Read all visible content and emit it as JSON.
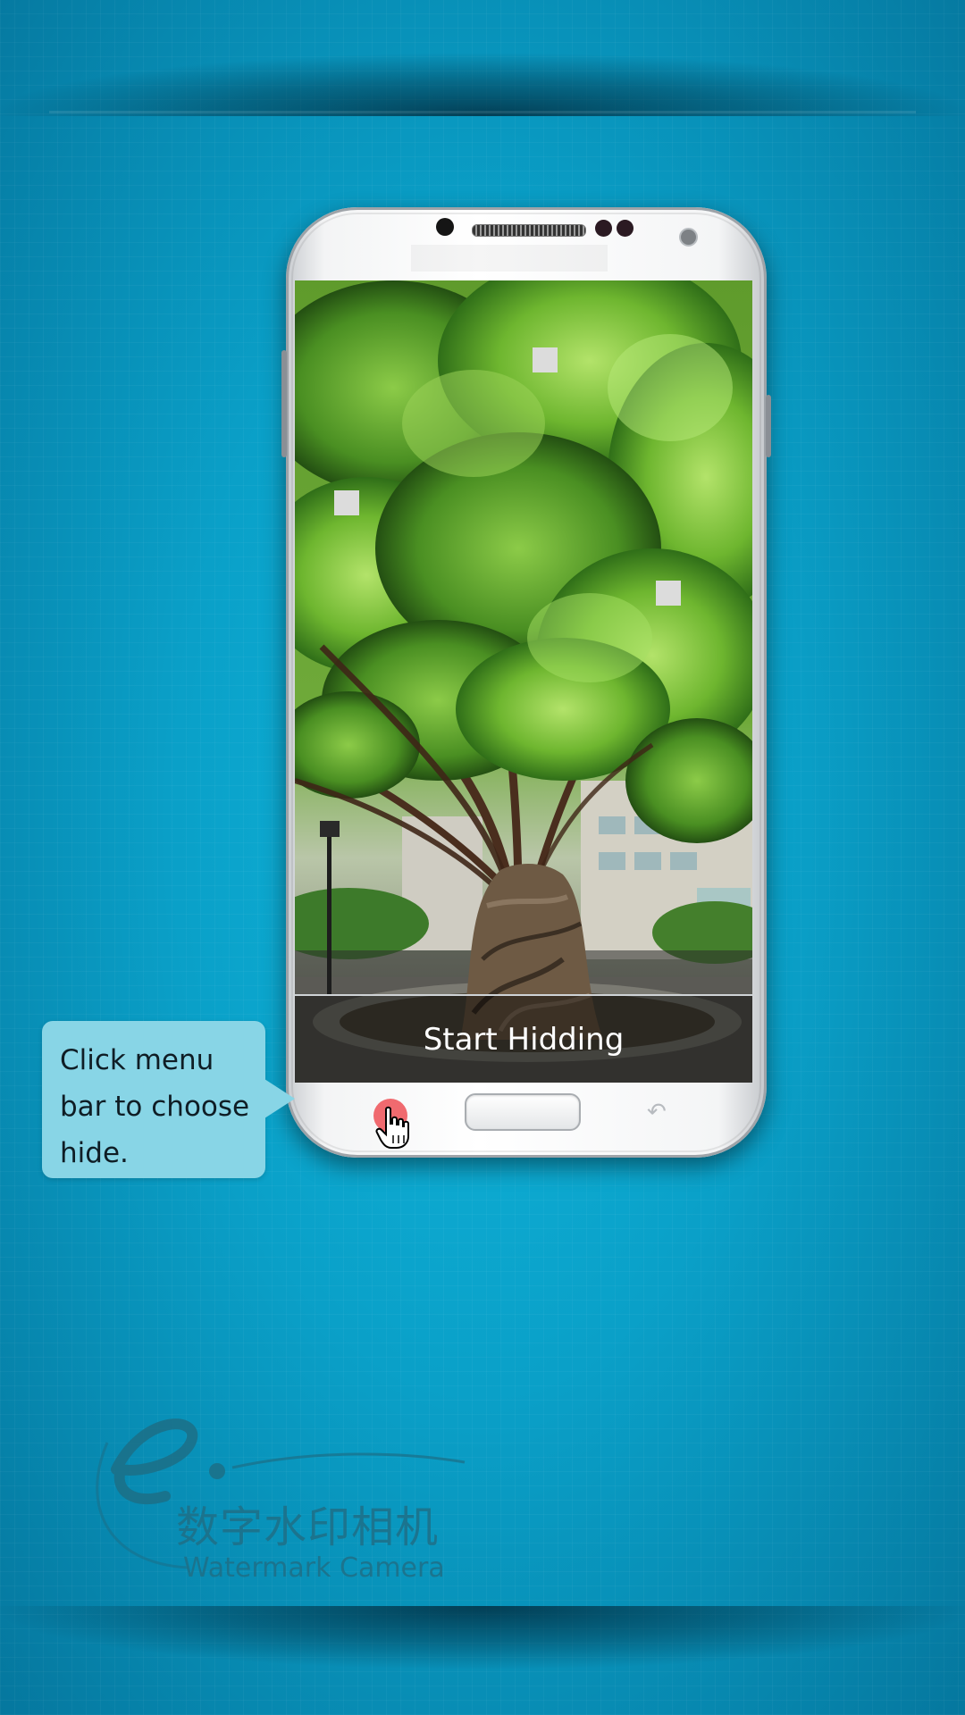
{
  "screen": {
    "action_label": "Start Hidding"
  },
  "tooltip": {
    "text": "Click menu\nbar to choose\nhide."
  },
  "brand": {
    "chinese_name": "数字水印相机",
    "english_name": "Watermark Camera"
  },
  "icons": {
    "menu_button": "menu-dot-icon",
    "back_button": "back-arrow-icon",
    "cursor": "hand-pointer-icon"
  },
  "colors": {
    "background": "#0aa0c8",
    "tooltip": "#88d5e6",
    "menu_dot": "#f06a6f",
    "brand": "#1f6f87"
  }
}
